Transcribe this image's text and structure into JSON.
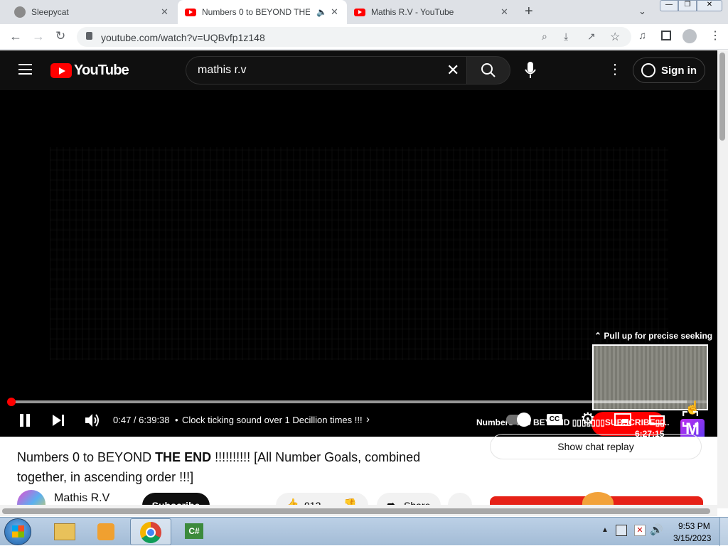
{
  "browser": {
    "tabs": [
      {
        "title": "Sleepycat",
        "favicon": "cat-icon"
      },
      {
        "title": "Numbers 0 to BEYOND THE",
        "favicon": "youtube-icon",
        "audio": true,
        "active": true
      },
      {
        "title": "Mathis R.V - YouTube",
        "favicon": "youtube-icon"
      }
    ],
    "url": "youtube.com/watch?v=UQBvfp1z148"
  },
  "youtube": {
    "logo_text": "YouTube",
    "search_value": "mathis r.v",
    "sign_in_label": "Sign in"
  },
  "player": {
    "seek_hint": "Pull up for precise seeking",
    "preview_title": "Numbers 0 to BEYOND ▯▯▯▯▯▯▯SUBSCRIBE▯▯...",
    "preview_time": "6:27:15",
    "time_display": "0:47 / 6:39:38",
    "chapter": "Clock ticking sound over 1 Decillion times !!!",
    "progress_fraction": 0.002,
    "hover_fraction": 0.97
  },
  "video_info": {
    "title_line1_a": "Numbers 0 to BEYOND ",
    "title_line1_b": "THE END",
    "title_line1_c": " !!!!!!!!!! [All Number Goals, combined",
    "title_line2": "together, in ascending order !!!]",
    "channel_name": "Mathis R.V",
    "subscribe_label": "Subscribe",
    "likes": "912",
    "share_label": "Share",
    "chat_replay_label": "Show chat replay"
  },
  "taskbar": {
    "time": "9:53 PM",
    "date": "3/15/2023"
  },
  "colors": {
    "yt_red": "#ff0000",
    "player_bg": "#000000",
    "header_bg": "#0f0f0f"
  }
}
